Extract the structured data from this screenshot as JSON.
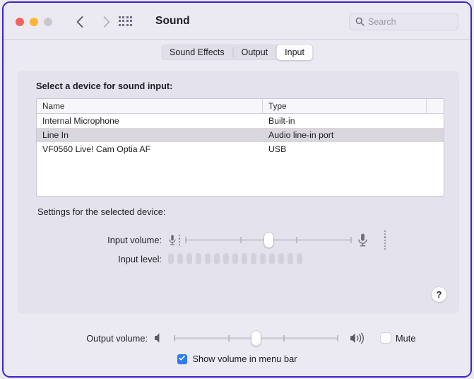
{
  "window": {
    "title": "Sound",
    "traffic_lights": [
      "close",
      "minimize",
      "zoom"
    ],
    "border_color": "#3d22c9"
  },
  "toolbar": {
    "back_icon": "chevron-left-icon",
    "forward_icon": "chevron-right-icon",
    "grid_icon": "grid-apps-icon",
    "search": {
      "placeholder": "Search",
      "value": "",
      "icon": "search-icon"
    }
  },
  "tabs": [
    {
      "label": "Sound Effects",
      "selected": false
    },
    {
      "label": "Output",
      "selected": false
    },
    {
      "label": "Input",
      "selected": true
    }
  ],
  "panel": {
    "prompt": "Select a device for sound input:",
    "table": {
      "columns": [
        "Name",
        "Type"
      ],
      "rows": [
        {
          "name": "Internal Microphone",
          "type": "Built-in",
          "selected": false
        },
        {
          "name": "Line In",
          "type": "Audio line-in port",
          "selected": true
        },
        {
          "name": "VF0560 Live! Cam Optia AF",
          "type": "USB",
          "selected": false
        }
      ]
    },
    "settings_label": "Settings for the selected device:",
    "input_volume": {
      "label": "Input volume:",
      "value_percent": 50,
      "left_icon": "microphone-small-icon",
      "right_icon": "microphone-large-icon"
    },
    "input_level": {
      "label": "Input level:",
      "segments": 15,
      "active_segments": 0
    },
    "help_button": {
      "label": "?",
      "icon": "question-mark-icon"
    }
  },
  "bottom": {
    "output_volume": {
      "label": "Output volume:",
      "value_percent": 50,
      "left_icon": "speaker-mute-icon",
      "right_icon": "speaker-wave-icon"
    },
    "mute": {
      "label": "Mute",
      "checked": false
    },
    "show_volume_menu_bar": {
      "label": "Show volume in menu bar",
      "checked": true
    }
  },
  "colors": {
    "window_bg": "#ebeaf2",
    "panel_bg": "#e4e2ec",
    "accent_blue": "#2b7cf7",
    "selected_row": "#d9d7dd"
  }
}
